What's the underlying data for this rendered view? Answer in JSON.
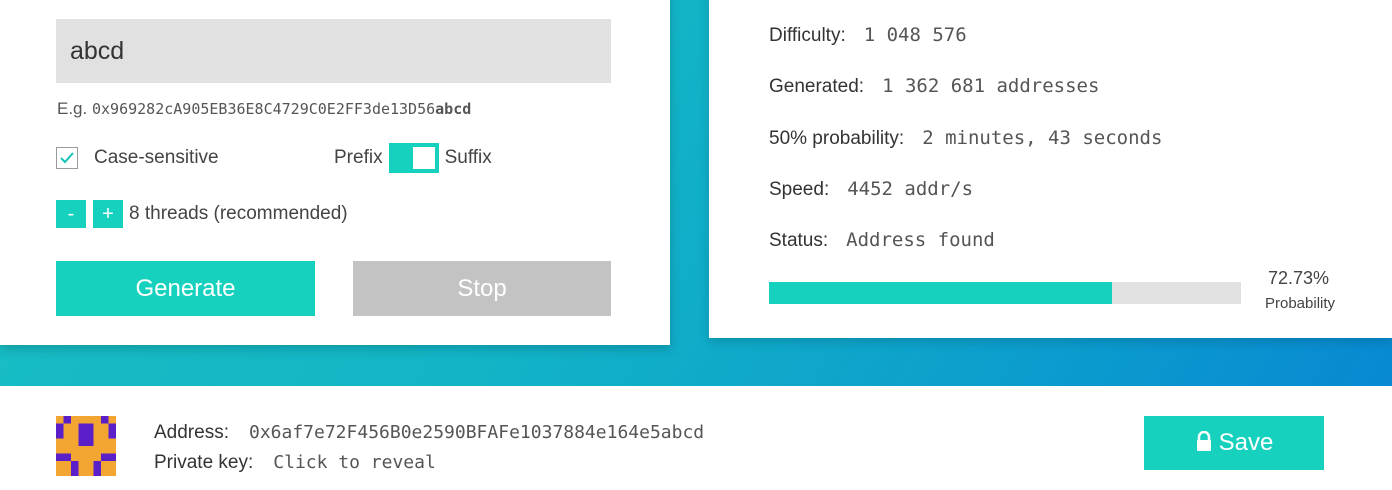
{
  "generator": {
    "input_value": "abcd",
    "example_prefix": "E.g.",
    "example_address": "0x969282cA905EB36E8C4729C0E2FF3de13D56",
    "example_suffix": "abcd",
    "case_sensitive_label": "Case-sensitive",
    "case_sensitive_checked": true,
    "prefix_label": "Prefix",
    "suffix_label": "Suffix",
    "minus_label": "-",
    "plus_label": "+",
    "threads_label": "8 threads (recommended)",
    "generate_label": "Generate",
    "stop_label": "Stop"
  },
  "stats": {
    "difficulty_label": "Difficulty:",
    "difficulty_value": "1 048 576",
    "generated_label": "Generated:",
    "generated_value": "1 362 681 addresses",
    "probability50_label": "50% probability:",
    "probability50_value": "2 minutes, 43 seconds",
    "speed_label": "Speed:",
    "speed_value": "4452 addr/s",
    "status_label": "Status:",
    "status_value": "Address found",
    "probability_percent": "72.73%",
    "probability_fraction": 0.7273,
    "probability_label": "Probability"
  },
  "result": {
    "address_label": "Address:",
    "address_value": "0x6af7e72F456B0e2590BFAFe1037884e164e5abcd",
    "private_key_label": "Private key:",
    "private_key_value": "Click to reveal",
    "save_label": "Save"
  },
  "colors": {
    "accent": "#15d1bd",
    "disabled": "#c3c3c3",
    "identicon_purple": "#5a1fc9",
    "identicon_orange": "#f2a531"
  },
  "icons": {
    "checkbox": "check-icon",
    "save": "lock-icon",
    "avatar": "identicon"
  }
}
